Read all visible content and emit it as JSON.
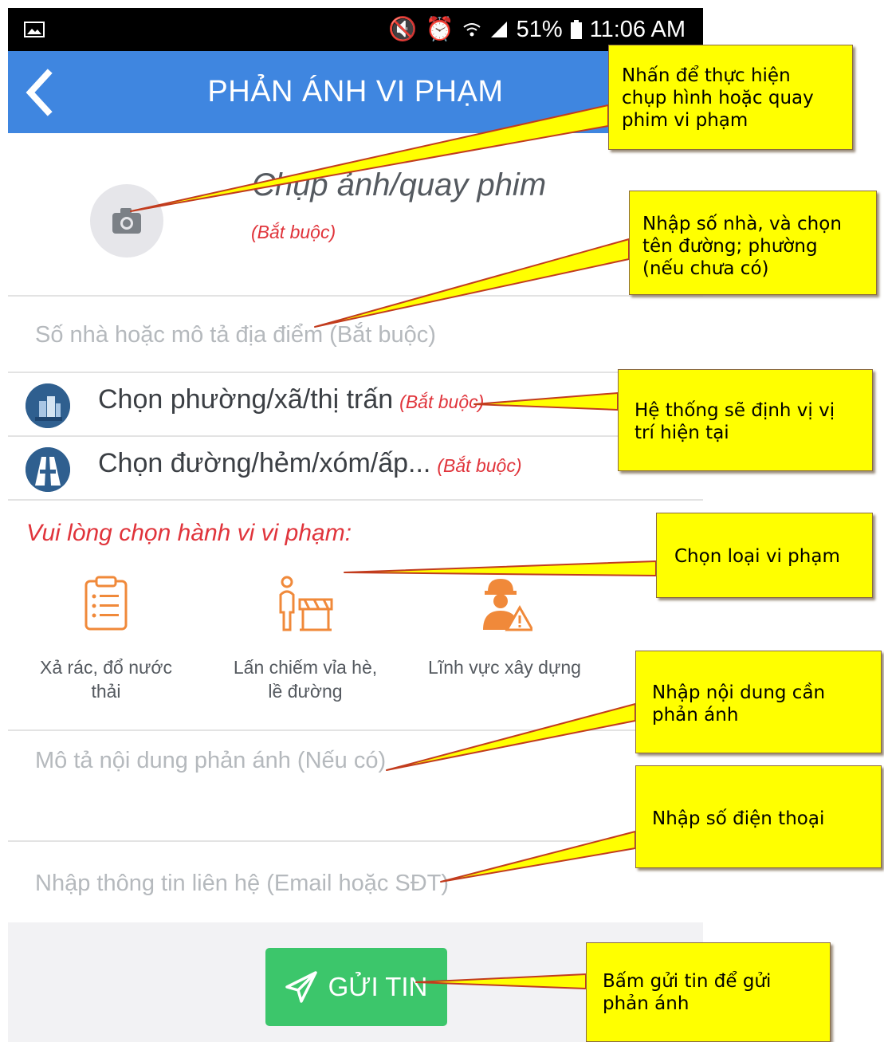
{
  "status_bar": {
    "battery": "51%",
    "time": "11:06 AM"
  },
  "app_bar": {
    "title": "PHẢN ÁNH VI PHẠM"
  },
  "photo": {
    "label": "Chụp ảnh/quay phim",
    "required": "(Bắt buộc)"
  },
  "address": {
    "placeholder": "Số nhà hoặc mô tả địa điểm (Bắt buộc)"
  },
  "ward_select": {
    "label": "Chọn phường/xã/thị trấn",
    "required": "(Bắt buộc)"
  },
  "street_select": {
    "label": "Chọn đường/hẻm/xóm/ấp...",
    "required": "(Bắt buộc)"
  },
  "violation": {
    "title": "Vui lòng chọn hành vi vi phạm:",
    "categories": [
      {
        "label": "Xả rác, đổ nước thải"
      },
      {
        "label": "Lấn chiếm vỉa hè, lề đường"
      },
      {
        "label": "Lĩnh vực xây dựng"
      }
    ]
  },
  "description": {
    "placeholder": "Mô tả nội dung phản ánh (Nếu có)"
  },
  "contact": {
    "placeholder": "Nhập thông tin liên hệ (Email hoặc SĐT)"
  },
  "submit": {
    "label": "GỬI TIN"
  },
  "callouts": [
    "Nhấn để thực hiện chụp hình hoặc quay phim vi phạm",
    "Nhập số nhà, và chọn tên đường; phường (nếu chưa có)",
    "Hệ thống sẽ định vị vị trí hiện tại",
    "Chọn loại vi phạm",
    "Nhập nội dung cần phản ánh",
    "Nhập số điện thoại",
    "Bấm gửi tin để gửi phản ánh"
  ],
  "colors": {
    "app_bar": "#3f86e0",
    "required": "#e0343b",
    "submit": "#3cc66b",
    "callout": "#ffff00",
    "category_icon": "#f0893a"
  }
}
